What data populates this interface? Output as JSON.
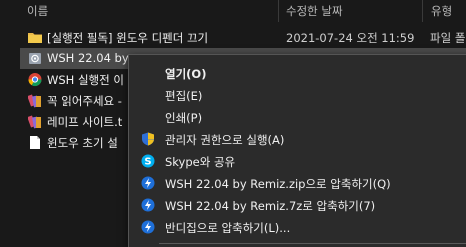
{
  "header": {
    "name_col": "이름",
    "date_col": "수정한 날짜",
    "type_col": "유형"
  },
  "files": [
    {
      "name": "[실행전 필독] 윈도우 디펜더 끄기",
      "date": "2021-07-24 오전 11:59",
      "type": "파일 폴",
      "icon": "folder-icon"
    },
    {
      "name": "WSH 22.04 by",
      "date": "",
      "type": "",
      "icon": "zip-archive-icon"
    },
    {
      "name": "WSH 실행전 이",
      "date": "",
      "type": "",
      "icon": "chrome-icon"
    },
    {
      "name": "꼭 읽어주세요 -",
      "date": "",
      "type": "",
      "icon": "winrar-icon"
    },
    {
      "name": "레미프 사이트.t",
      "date": "",
      "type": "",
      "icon": "winrar-icon"
    },
    {
      "name": "윈도우 초기 설",
      "date": "",
      "type": "",
      "icon": "document-icon"
    }
  ],
  "context_menu": {
    "items": [
      {
        "label": "열기(O)",
        "icon": "",
        "bold": true
      },
      {
        "label": "편집(E)",
        "icon": ""
      },
      {
        "label": "인쇄(P)",
        "icon": ""
      },
      {
        "label": "관리자 권한으로 실행(A)",
        "icon": "uac-shield-icon"
      },
      {
        "label": "Skype와 공유",
        "icon": "skype-icon"
      },
      {
        "label": "WSH 22.04 by Remiz.zip으로 압축하기(Q)",
        "icon": "bandizip-icon"
      },
      {
        "label": "WSH 22.04 by Remiz.7z로 압축하기(7)",
        "icon": "bandizip-icon"
      },
      {
        "label": "반디집으로 압축하기(L)...",
        "icon": "bandizip-icon"
      }
    ]
  },
  "colors": {
    "background": "#191919",
    "menu_background": "#2b2b2b",
    "selected_row": "#4a4a4a",
    "skype_blue": "#00aff0",
    "bandizip_blue": "#1e6fd9",
    "folder_yellow": "#e8b84a"
  }
}
